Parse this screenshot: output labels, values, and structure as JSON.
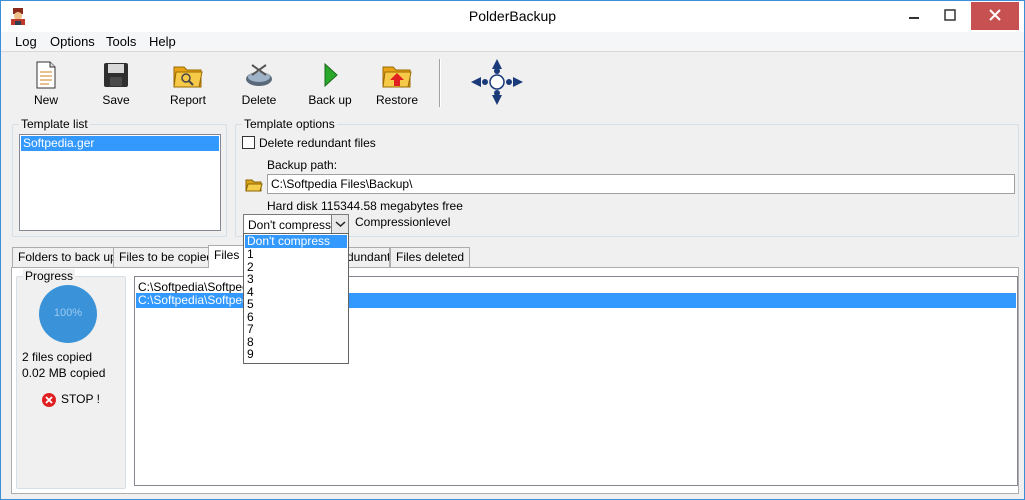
{
  "window": {
    "title": "PolderBackup",
    "controls": {
      "minimize": "—",
      "maximize": "☐",
      "close": "✕"
    },
    "accent": "#3c8fd6",
    "close_color": "#c75050"
  },
  "menu": [
    "Log",
    "Options",
    "Tools",
    "Help"
  ],
  "toolbar": {
    "new": "New",
    "save": "Save",
    "report": "Report",
    "delete": "Delete",
    "backup": "Back up",
    "restore": "Restore"
  },
  "template_list": {
    "caption": "Template list",
    "items": [
      "Softpedia.ger"
    ]
  },
  "template_options": {
    "caption": "Template options",
    "delete_redundant_label": "Delete redundant files",
    "delete_redundant_checked": false,
    "backup_path_label": "Backup path:",
    "backup_path_value": "C:\\Softpedia Files\\Backup\\",
    "hard_disk_text": "Hard disk 115344.58 megabytes free",
    "compression_value": "Don't compress",
    "compression_label": "Compressionlevel"
  },
  "tabs": {
    "folders": "Folders to back up",
    "to_copy": "Files to be copied",
    "copied": "Files c",
    "redundant": "dundant",
    "deleted": "Files deleted"
  },
  "progress": {
    "caption": "Progress",
    "percent_text": "100%",
    "files_copied": "2 files copied",
    "mb_copied": "0.02 MB copied",
    "stop_label": "STOP !"
  },
  "file_list": [
    "C:\\Softpedia\\Softpedi",
    "C:\\Softpedia\\Softpedi"
  ],
  "dropdown_options": [
    "Don't compress",
    "1",
    "2",
    "3",
    "4",
    "5",
    "6",
    "7",
    "8",
    "9"
  ],
  "colors": {
    "selection": "#3399ff",
    "progress_circle": "#3a93d8"
  }
}
